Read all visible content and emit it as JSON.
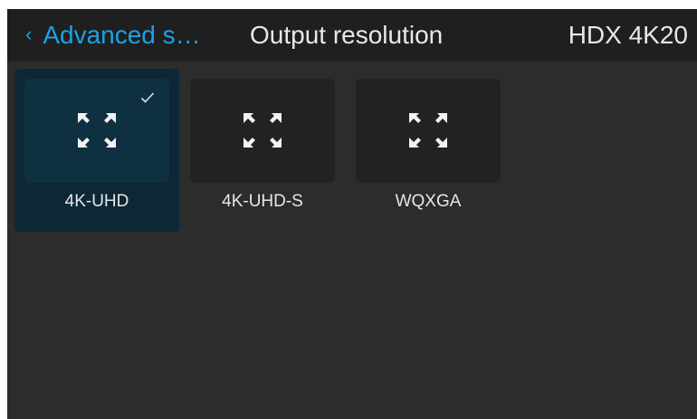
{
  "header": {
    "back_label": "Advanced s…",
    "title": "Output resolution",
    "device": "HDX 4K20"
  },
  "resolutions": [
    {
      "label": "4K-UHD",
      "selected": true,
      "icon": "expand-icon"
    },
    {
      "label": "4K-UHD-S",
      "selected": false,
      "icon": "expand-icon"
    },
    {
      "label": "WQXGA",
      "selected": false,
      "icon": "expand-icon"
    }
  ],
  "colors": {
    "accent": "#1ea1e6",
    "background": "#2c2c2c",
    "header": "#1f1f1f",
    "selected_tile": "#0d2736"
  }
}
